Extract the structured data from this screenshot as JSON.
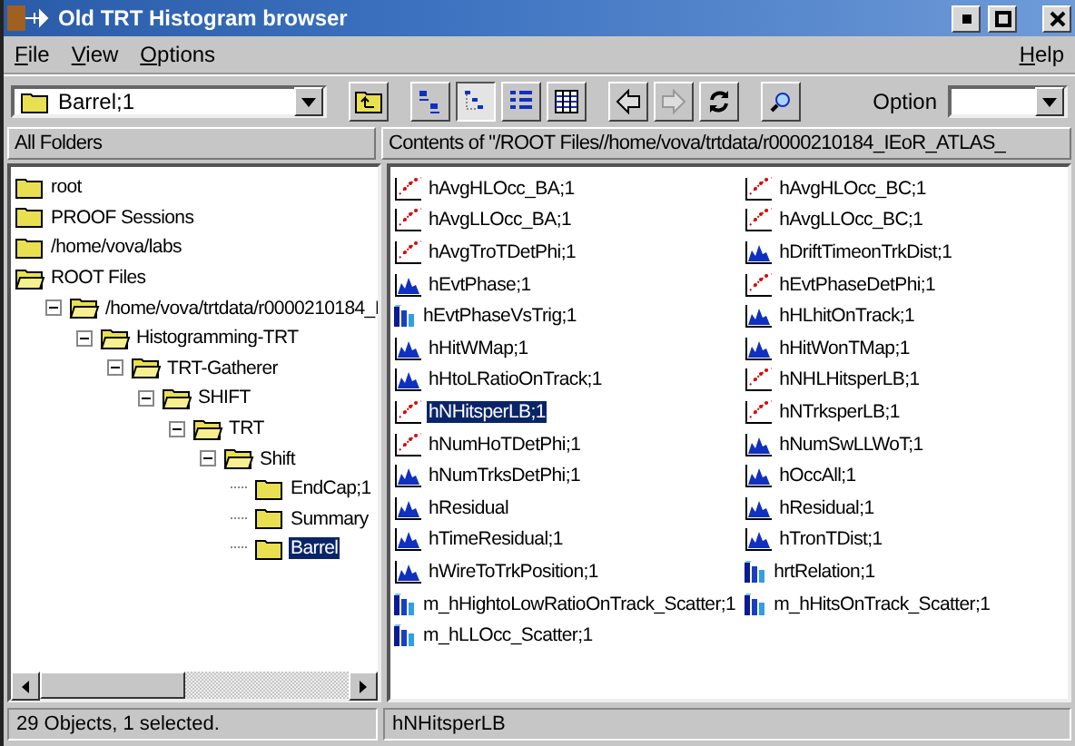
{
  "window": {
    "title": "Old TRT Histogram browser"
  },
  "menu": [
    "File",
    "View",
    "Options"
  ],
  "help_menu": "Help",
  "toolbar": {
    "location": "Barrel;1",
    "option_label": "Option",
    "buttons": [
      {
        "kind": "up",
        "pressed": false
      },
      {
        "kind": "large",
        "pressed": false
      },
      {
        "kind": "small",
        "pressed": true
      },
      {
        "kind": "list",
        "pressed": false
      },
      {
        "kind": "details",
        "pressed": false
      },
      {
        "kind": "back",
        "disabled": false
      },
      {
        "kind": "forward",
        "disabled": true
      },
      {
        "kind": "refresh",
        "disabled": false
      },
      {
        "kind": "find",
        "disabled": false
      }
    ]
  },
  "folders_header": "All Folders",
  "contents_header": "Contents of \"/ROOT Files//home/vova/trtdata/r0000210184_IEoR_ATLAS_",
  "tree": [
    {
      "label": "root",
      "expanded": false,
      "selected": false
    },
    {
      "label": "PROOF Sessions",
      "expanded": false,
      "selected": false
    },
    {
      "label": "/home/vova/labs",
      "expanded": false,
      "selected": false
    },
    {
      "label": "ROOT Files",
      "expanded": true,
      "selected": false,
      "children": [
        {
          "label": "/home/vova/trtdata/r0000210184_I",
          "expanded": true,
          "selected": false,
          "children": [
            {
              "label": "Histogramming-TRT",
              "expanded": true,
              "selected": false,
              "children": [
                {
                  "label": "TRT-Gatherer",
                  "expanded": true,
                  "selected": false,
                  "children": [
                    {
                      "label": "SHIFT",
                      "expanded": true,
                      "selected": false,
                      "children": [
                        {
                          "label": "TRT",
                          "expanded": true,
                          "selected": false,
                          "children": [
                            {
                              "label": "Shift",
                              "expanded": true,
                              "selected": false,
                              "children": [
                                {
                                  "label": "EndCap;1",
                                  "expanded": false,
                                  "selected": false
                                },
                                {
                                  "label": "Summary",
                                  "expanded": false,
                                  "selected": false
                                },
                                {
                                  "label": "Barrel",
                                  "expanded": false,
                                  "selected": true
                                }
                              ]
                            }
                          ]
                        }
                      ]
                    }
                  ]
                }
              ]
            }
          ]
        }
      ]
    }
  ],
  "items": [
    {
      "label": "hAvgHLOcc_BA;1",
      "kind": "graph",
      "selected": false
    },
    {
      "label": "hAvgLLOcc_BA;1",
      "kind": "graph",
      "selected": false
    },
    {
      "label": "hAvgTroTDetPhi;1",
      "kind": "graph",
      "selected": false
    },
    {
      "label": "hEvtPhase;1",
      "kind": "hist",
      "selected": false
    },
    {
      "label": "hEvtPhaseVsTrig;1",
      "kind": "hist2d",
      "selected": false
    },
    {
      "label": "hHitWMap;1",
      "kind": "hist",
      "selected": false
    },
    {
      "label": "hHtoLRatioOnTrack;1",
      "kind": "hist",
      "selected": false
    },
    {
      "label": "hNHitsperLB;1",
      "kind": "graph",
      "selected": true
    },
    {
      "label": "hNumHoTDetPhi;1",
      "kind": "graph",
      "selected": false
    },
    {
      "label": "hNumTrksDetPhi;1",
      "kind": "hist",
      "selected": false
    },
    {
      "label": "hResidual",
      "kind": "hist",
      "selected": false
    },
    {
      "label": "hTimeResidual;1",
      "kind": "hist",
      "selected": false
    },
    {
      "label": "hWireToTrkPosition;1",
      "kind": "hist",
      "selected": false
    },
    {
      "label": "m_hHightoLowRatioOnTrack_Scatter;1",
      "kind": "hist2d",
      "selected": false
    },
    {
      "label": "m_hLLOcc_Scatter;1",
      "kind": "hist2d",
      "selected": false
    },
    {
      "label": "hAvgHLOcc_BC;1",
      "kind": "graph",
      "selected": false
    },
    {
      "label": "hAvgLLOcc_BC;1",
      "kind": "graph",
      "selected": false
    },
    {
      "label": "hDriftTimeonTrkDist;1",
      "kind": "hist",
      "selected": false
    },
    {
      "label": "hEvtPhaseDetPhi;1",
      "kind": "graph",
      "selected": false
    },
    {
      "label": "hHLhitOnTrack;1",
      "kind": "hist",
      "selected": false
    },
    {
      "label": "hHitWonTMap;1",
      "kind": "hist",
      "selected": false
    },
    {
      "label": "hNHLHitsperLB;1",
      "kind": "graph",
      "selected": false
    },
    {
      "label": "hNTrksperLB;1",
      "kind": "graph",
      "selected": false
    },
    {
      "label": "hNumSwLLWoT;1",
      "kind": "hist",
      "selected": false
    },
    {
      "label": "hOccAll;1",
      "kind": "hist",
      "selected": false
    },
    {
      "label": "hResidual;1",
      "kind": "hist",
      "selected": false
    },
    {
      "label": "hTronTDist;1",
      "kind": "hist",
      "selected": false
    },
    {
      "label": "hrtRelation;1",
      "kind": "hist2d",
      "selected": false
    },
    {
      "label": "m_hHitsOnTrack_Scatter;1",
      "kind": "hist2d",
      "selected": false
    }
  ],
  "status_bar": [
    "29 Objects, 1 selected.",
    "hNHitsperLB"
  ]
}
